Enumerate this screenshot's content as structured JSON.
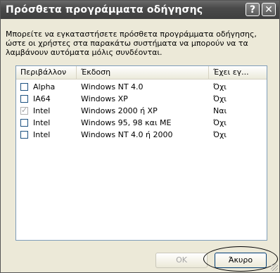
{
  "window": {
    "title": "Πρόσθετα προγράμματα οδήγησης",
    "help_label": "?",
    "close_label": "✕"
  },
  "intro": "Μπορείτε να εγκαταστήσετε πρόσθετα προγράμματα οδήγησης, ώστε οι χρήστες στα παρακάτω συστήματα να μπορούν να τα λαμβάνουν αυτόματα μόλις συνδέονται.",
  "table": {
    "columns": [
      "Περιβάλλον",
      "Έκδοση",
      "Έχει εγ..."
    ],
    "rows": [
      {
        "env": "Alpha",
        "version": "Windows NT 4.0",
        "installed": "Όχι",
        "checked": false
      },
      {
        "env": "IA64",
        "version": "Windows XP",
        "installed": "Όχι",
        "checked": false
      },
      {
        "env": "Intel",
        "version": "Windows 2000 ή XP",
        "installed": "Ναι",
        "checked": true
      },
      {
        "env": "Intel",
        "version": "Windows 95, 98 και ME",
        "installed": "Όχι",
        "checked": false
      },
      {
        "env": "Intel",
        "version": "Windows NT 4.0 ή 2000",
        "installed": "Όχι",
        "checked": false
      }
    ]
  },
  "buttons": {
    "ok": "OK",
    "cancel": "Άκυρο"
  }
}
